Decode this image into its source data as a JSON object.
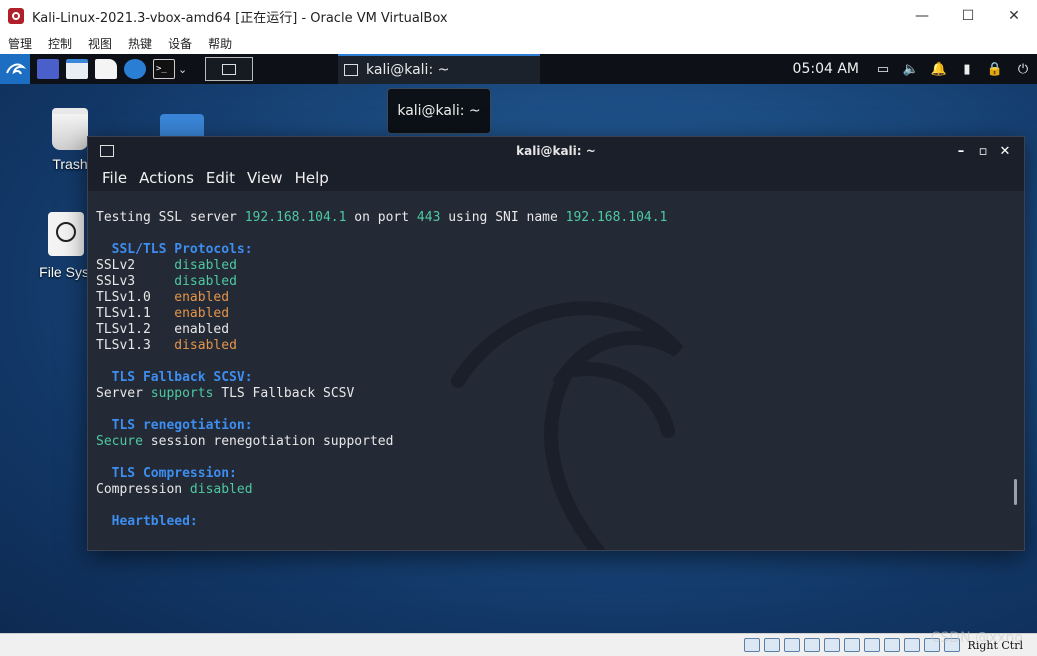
{
  "vbox": {
    "window_title": "Kali-Linux-2021.3-vbox-amd64 [正在运行] - Oracle VM VirtualBox",
    "menu": [
      "管理",
      "控制",
      "视图",
      "热键",
      "设备",
      "帮助"
    ],
    "host_key": "Right Ctrl"
  },
  "panel": {
    "task_label": "kali@kali: ~",
    "clock": "05:04 AM"
  },
  "tooltip": "kali@kali: ~",
  "desktop": {
    "trash_label": "Trash",
    "filesystem_label": "File Syst"
  },
  "terminal": {
    "title": "kali@kali: ~",
    "menu": [
      "File",
      "Actions",
      "Edit",
      "View",
      "Help"
    ],
    "lines": [
      [
        [
          "Testing SSL server ",
          "white"
        ],
        [
          "192.168.104.1",
          "green"
        ],
        [
          " on port ",
          "white"
        ],
        [
          "443",
          "green"
        ],
        [
          " using SNI name ",
          "white"
        ],
        [
          "192.168.104.1",
          "green"
        ]
      ],
      [],
      [
        [
          "  SSL/TLS Protocols:",
          "blue"
        ]
      ],
      [
        [
          "SSLv2     ",
          "white"
        ],
        [
          "disabled",
          "green"
        ]
      ],
      [
        [
          "SSLv3     ",
          "white"
        ],
        [
          "disabled",
          "green"
        ]
      ],
      [
        [
          "TLSv1.0   ",
          "white"
        ],
        [
          "enabled",
          "orange"
        ]
      ],
      [
        [
          "TLSv1.1   ",
          "white"
        ],
        [
          "enabled",
          "orange"
        ]
      ],
      [
        [
          "TLSv1.2   ",
          "white"
        ],
        [
          "enabled",
          "white"
        ]
      ],
      [
        [
          "TLSv1.3   ",
          "white"
        ],
        [
          "disabled",
          "orange"
        ]
      ],
      [],
      [
        [
          "  TLS Fallback SCSV:",
          "blue"
        ]
      ],
      [
        [
          "Server ",
          "white"
        ],
        [
          "supports",
          "green"
        ],
        [
          " TLS Fallback SCSV",
          "white"
        ]
      ],
      [],
      [
        [
          "  TLS renegotiation:",
          "blue"
        ]
      ],
      [
        [
          "Secure",
          "green"
        ],
        [
          " session renegotiation supported",
          "white"
        ]
      ],
      [],
      [
        [
          "  TLS Compression:",
          "blue"
        ]
      ],
      [
        [
          "Compression ",
          "white"
        ],
        [
          "disabled",
          "green"
        ]
      ],
      [],
      [
        [
          "  Heartbleed:",
          "blue"
        ]
      ]
    ]
  },
  "watermark": "CSDN @xxno"
}
